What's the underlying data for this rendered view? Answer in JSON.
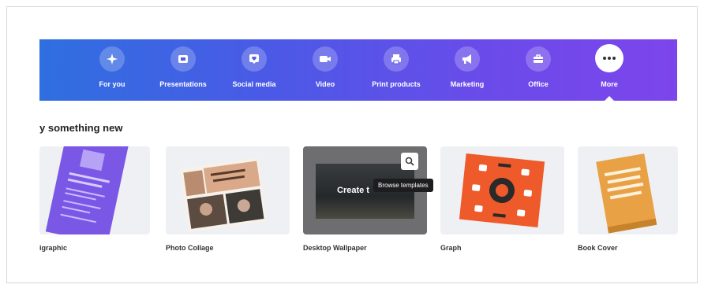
{
  "categories": [
    {
      "label": "For you",
      "icon": "sparkle-icon"
    },
    {
      "label": "Presentations",
      "icon": "presentation-icon"
    },
    {
      "label": "Social media",
      "icon": "heart-icon"
    },
    {
      "label": "Video",
      "icon": "video-icon"
    },
    {
      "label": "Print products",
      "icon": "print-icon"
    },
    {
      "label": "Marketing",
      "icon": "megaphone-icon"
    },
    {
      "label": "Office",
      "icon": "briefcase-icon"
    },
    {
      "label": "More",
      "icon": "more-icon"
    }
  ],
  "section": {
    "title": "y something new"
  },
  "cards": [
    {
      "label": "igraphic"
    },
    {
      "label": "Photo Collage"
    },
    {
      "label": "Desktop Wallpaper",
      "overlay_text": "Create t",
      "tooltip": "Browse templates"
    },
    {
      "label": "Graph"
    },
    {
      "label": "Book Cover"
    }
  ],
  "colors": {
    "banner_start": "#2f6fe0",
    "banner_end": "#7d45ec",
    "infographic": "#7b57e6",
    "graph": "#ee5a2a",
    "book": "#e8a144"
  }
}
